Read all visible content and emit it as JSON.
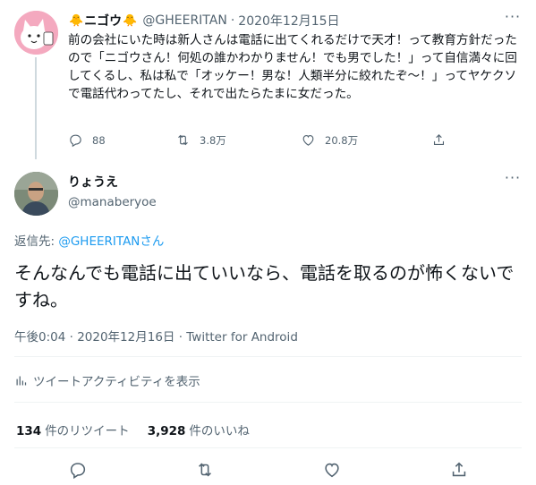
{
  "parent_tweet": {
    "display_name_prefix": "🐥",
    "display_name": "ニゴウ",
    "display_name_suffix": "🐥",
    "handle": "@GHEERITAN",
    "separator": "·",
    "date": "2020年12月15日",
    "text": "前の会社にいた時は新人さんは電話に出てくれるだけで天才！って教育方針だったので「ニゴウさん！何処の誰かわかりません！でも男でした！」って自信満々に回してくるし、私は私で「オッケー！男な！人類半分に絞れたぞ〜！」ってヤケクソで電話代わってたし、それで出たらたまに女だった。",
    "replies": "88",
    "retweets": "3.8万",
    "likes": "20.8万"
  },
  "main_tweet": {
    "display_name": "りょうえ",
    "handle": "@manaberyoe",
    "reply_prefix": "返信先: ",
    "reply_to": "@GHEERITAN",
    "reply_suffix": "さん",
    "text": "そんなんでも電話に出ていいなら、電話を取るのが怖くないですね。",
    "time": "午後0:04",
    "meta_sep": " · ",
    "date": "2020年12月16日",
    "source": "Twitter for Android",
    "activity_label": "ツイートアクティビティを表示",
    "retweet_count": "134",
    "retweet_label": "件のリツイート",
    "like_count": "3,928",
    "like_label": "件のいいね"
  },
  "colors": {
    "accent": "#1d9bf0",
    "text": "#0f1419",
    "muted": "#536471",
    "divider": "#eff3f4"
  },
  "icons": {
    "more": "more-icon",
    "reply": "reply-icon",
    "retweet": "retweet-icon",
    "like": "heart-icon",
    "share": "share-icon",
    "activity": "bar-chart-icon"
  }
}
